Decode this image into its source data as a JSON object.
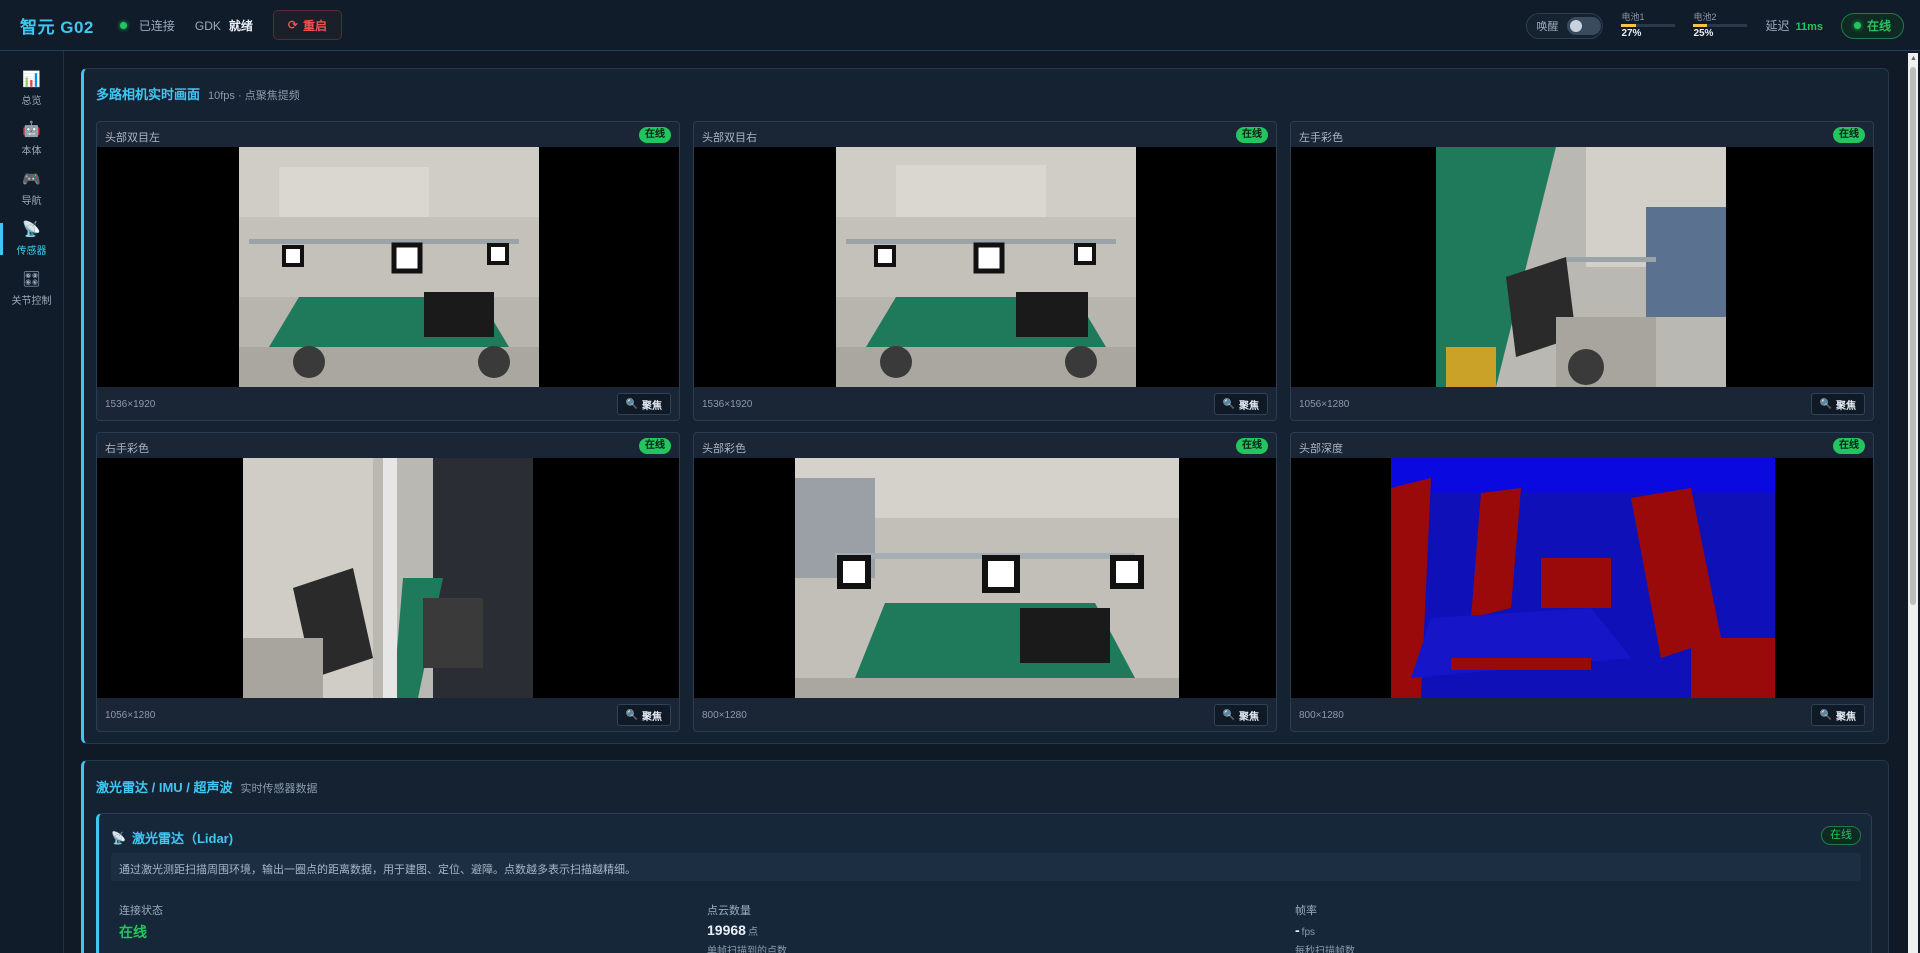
{
  "header": {
    "brand": "智元 G02",
    "connection": "已连接",
    "gdk_label": "GDK",
    "gdk_state": "就绪",
    "restart_label": "重启",
    "wake_label": "唤醒",
    "battery1": {
      "label": "电池1",
      "pct": "27%",
      "level": 0.27
    },
    "battery2": {
      "label": "电池2",
      "pct": "25%",
      "level": 0.25
    },
    "latency_label": "延迟",
    "latency_value": "11ms",
    "online_label": "在线"
  },
  "sidebar": {
    "items": [
      {
        "label": "总览",
        "icon": "bar-chart-icon"
      },
      {
        "label": "本体",
        "icon": "robot-icon"
      },
      {
        "label": "导航",
        "icon": "gamepad-icon"
      },
      {
        "label": "传感器",
        "icon": "satellite-dish-icon",
        "active": true
      },
      {
        "label": "关节控制",
        "icon": "joint-grid-icon"
      }
    ]
  },
  "cameras_panel": {
    "title": "多路相机实时画面",
    "subtitle": "10fps · 点聚焦提频",
    "focus_label": "聚焦",
    "cameras": [
      {
        "name": "头部双目左",
        "status": "在线",
        "resolution": "1536×1920"
      },
      {
        "name": "头部双目右",
        "status": "在线",
        "resolution": "1536×1920"
      },
      {
        "name": "左手彩色",
        "status": "在线",
        "resolution": "1056×1280"
      },
      {
        "name": "右手彩色",
        "status": "在线",
        "resolution": "1056×1280"
      },
      {
        "name": "头部彩色",
        "status": "在线",
        "resolution": "800×1280"
      },
      {
        "name": "头部深度",
        "status": "在线",
        "resolution": "800×1280"
      }
    ]
  },
  "sensors_panel": {
    "title": "激光雷达 / IMU / 超声波",
    "subtitle": "实时传感器数据",
    "lidar": {
      "title": "激光雷达（Lidar)",
      "status": "在线",
      "description": "通过激光测距扫描周围环境，输出一圈点的距离数据，用于建图、定位、避障。点数越多表示扫描越精细。",
      "stats": [
        {
          "key": "连接状态",
          "value": "在线",
          "unit": "",
          "hint": ""
        },
        {
          "key": "点云数量",
          "value": "19968",
          "unit": "点",
          "hint": "单帧扫描到的点数"
        },
        {
          "key": "帧率",
          "value": "-",
          "unit": "fps",
          "hint": "每秒扫描帧数"
        }
      ]
    }
  },
  "colors": {
    "accent": "#3fc7f2",
    "online": "#22c55e",
    "danger": "#f05252",
    "bg": "#0f1a26"
  }
}
